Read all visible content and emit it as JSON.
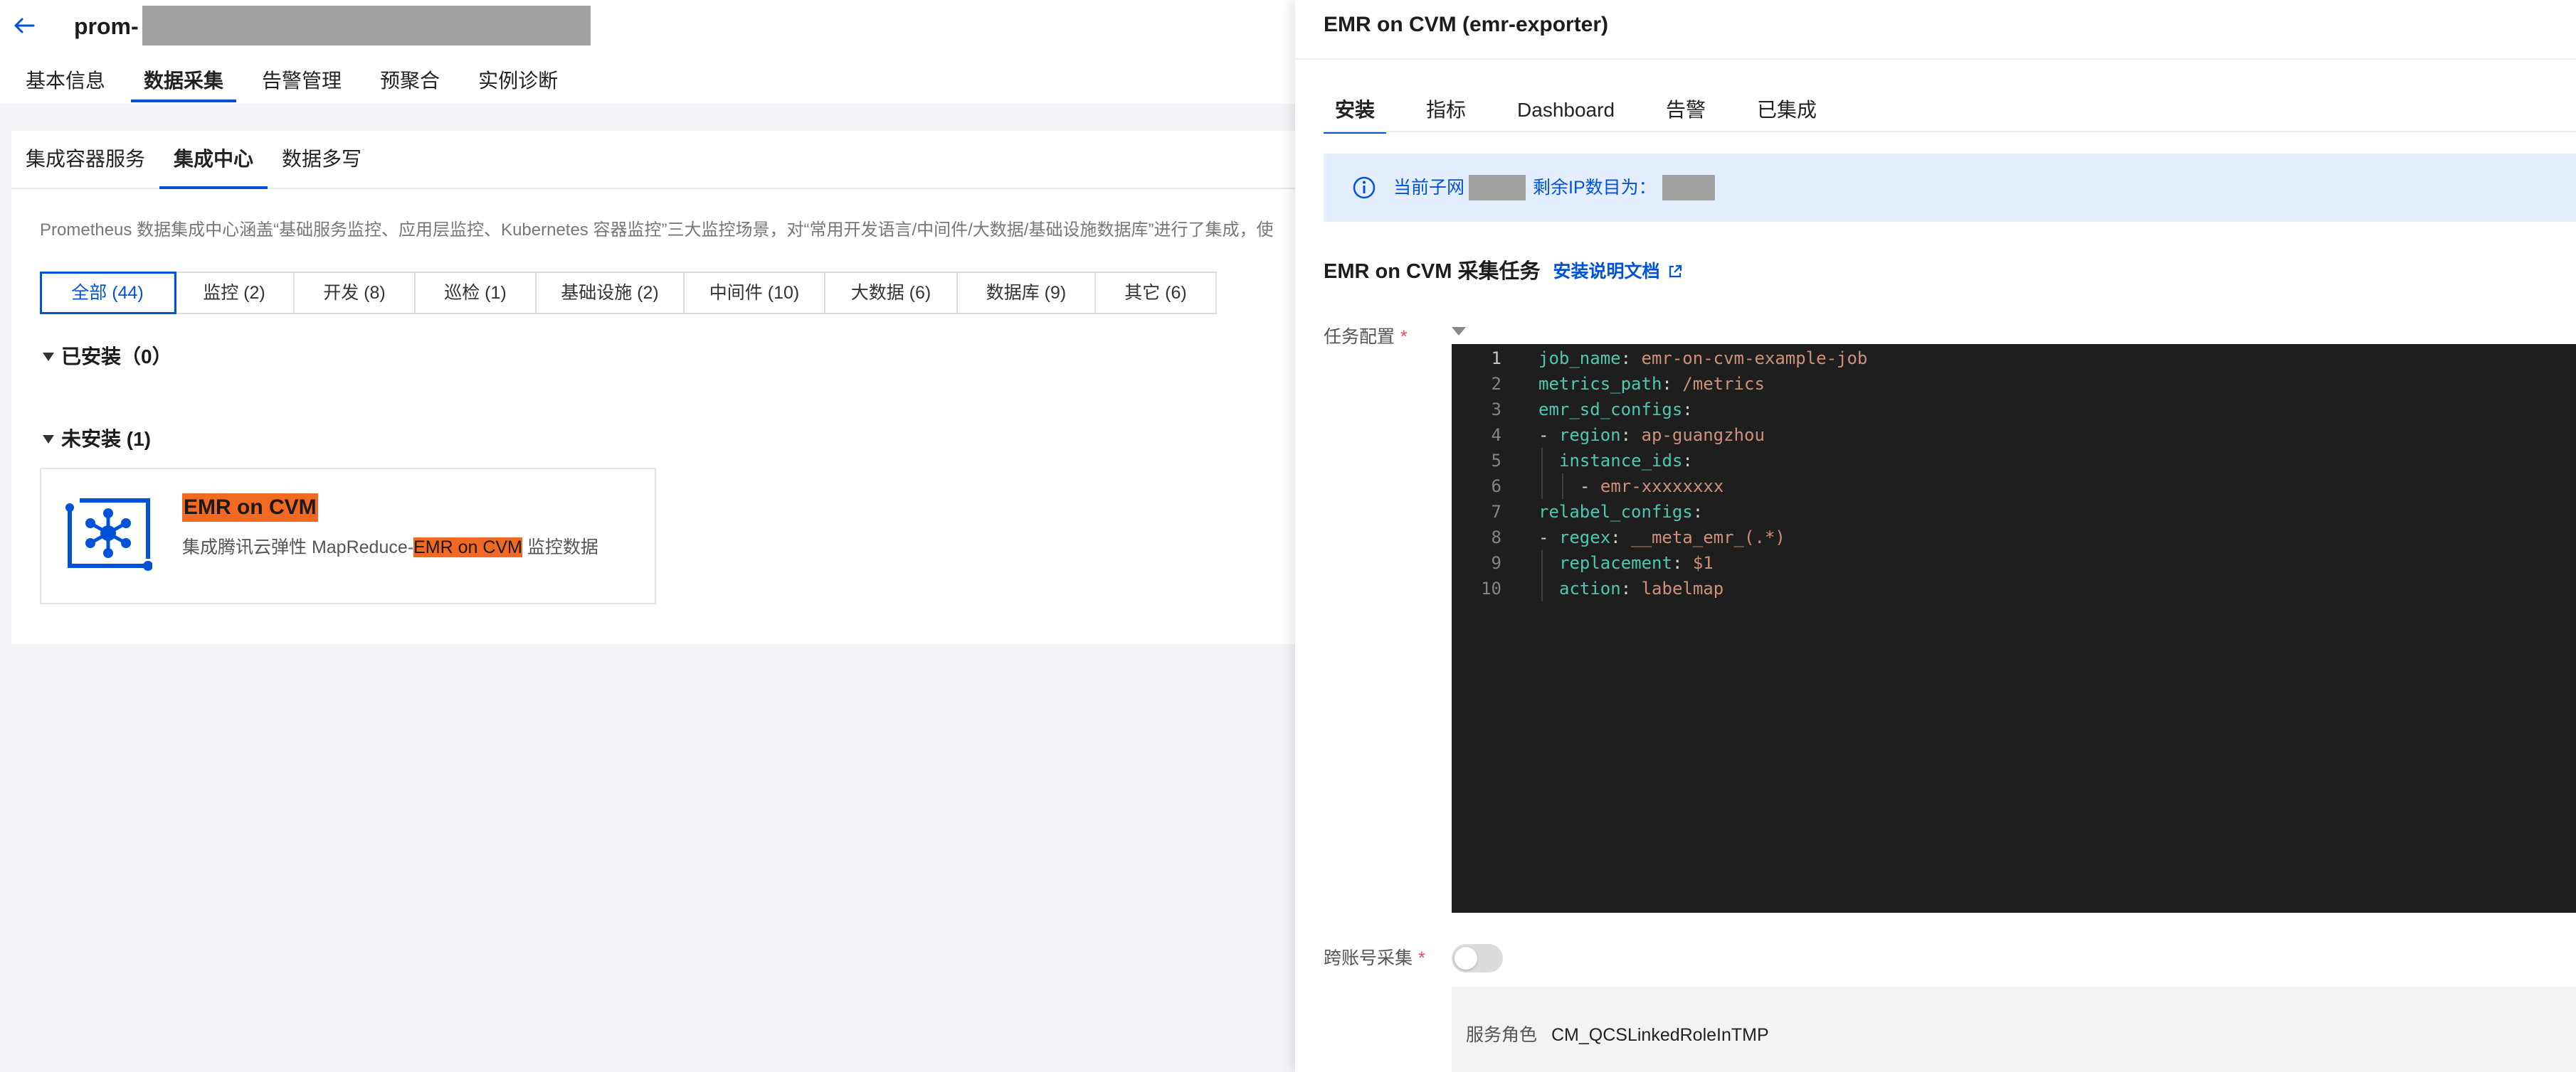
{
  "header": {
    "instance_prefix": "prom-",
    "tabs": [
      {
        "label": "基本信息",
        "active": false
      },
      {
        "label": "数据采集",
        "active": true
      },
      {
        "label": "告警管理",
        "active": false
      },
      {
        "label": "预聚合",
        "active": false
      },
      {
        "label": "实例诊断",
        "active": false
      }
    ]
  },
  "collect": {
    "sub_tabs": [
      {
        "label": "集成容器服务",
        "active": false
      },
      {
        "label": "集成中心",
        "active": true
      },
      {
        "label": "数据多写",
        "active": false
      }
    ],
    "intro": "Prometheus 数据集成中心涵盖“基础服务监控、应用层监控、Kubernetes 容器监控”三大监控场景，对“常用开发语言/中间件/大数据/基础设施数据库”进行了集成，使",
    "filters": [
      {
        "label": "全部 (44)",
        "active": true
      },
      {
        "label": "监控 (2)",
        "active": false
      },
      {
        "label": "开发 (8)",
        "active": false
      },
      {
        "label": "巡检 (1)",
        "active": false
      },
      {
        "label": "基础设施 (2)",
        "active": false
      },
      {
        "label": "中间件 (10)",
        "active": false
      },
      {
        "label": "大数据 (6)",
        "active": false
      },
      {
        "label": "数据库 (9)",
        "active": false
      },
      {
        "label": "其它 (6)",
        "active": false
      }
    ],
    "installed_title": "已安装（0）",
    "not_installed_title": "未安装 (1)",
    "card": {
      "name": "EMR on CVM",
      "desc_prefix": "集成腾讯云弹性 MapReduce-",
      "desc_highlight": "EMR on CVM",
      "desc_suffix": " 监控数据"
    }
  },
  "drawer": {
    "title": "EMR on CVM (emr-exporter)",
    "tabs": [
      {
        "label": "安装",
        "active": true
      },
      {
        "label": "指标",
        "active": false
      },
      {
        "label": "Dashboard",
        "active": false
      },
      {
        "label": "告警",
        "active": false
      },
      {
        "label": "已集成",
        "active": false
      }
    ],
    "info": {
      "subnet_label": "当前子网",
      "remaining_label": "剩余IP数目为："
    },
    "task_title": "EMR on CVM 采集任务",
    "doc_link": "安装说明文档",
    "config_label": "任务配置",
    "code_lines": [
      {
        "n": "1",
        "indent": 0,
        "key": "job_name",
        "sep": ": ",
        "val": "emr-on-cvm-example-job"
      },
      {
        "n": "2",
        "indent": 0,
        "key": "metrics_path",
        "sep": ": ",
        "val": "/metrics"
      },
      {
        "n": "3",
        "indent": 0,
        "key": "emr_sd_configs",
        "sep": ":",
        "val": ""
      },
      {
        "n": "4",
        "indent": 0,
        "key": "region",
        "sep": ": ",
        "val": "ap-guangzhou",
        "dash": true
      },
      {
        "n": "5",
        "indent": 1,
        "key": "instance_ids",
        "sep": ":",
        "val": ""
      },
      {
        "n": "6",
        "indent": 2,
        "key": "",
        "sep": "",
        "val": "emr-xxxxxxxx",
        "dash": true
      },
      {
        "n": "7",
        "indent": 0,
        "key": "relabel_configs",
        "sep": ":",
        "val": ""
      },
      {
        "n": "8",
        "indent": 0,
        "key": "regex",
        "sep": ": ",
        "val": "__meta_emr_(.*)",
        "dash": true
      },
      {
        "n": "9",
        "indent": 1,
        "key": "replacement",
        "sep": ": ",
        "val": "$1"
      },
      {
        "n": "10",
        "indent": 1,
        "key": "action",
        "sep": ": ",
        "val": "labelmap"
      }
    ],
    "cross_account_label": "跨账号采集",
    "cross_account_enabled": false,
    "role_label": "服务角色",
    "role_value": "CM_QCSLinkedRoleInTMP"
  },
  "colors": {
    "accent": "#0052d9",
    "highlight": "#f26a21",
    "required": "#e34d59",
    "editor_bg": "#1e1e1e"
  }
}
